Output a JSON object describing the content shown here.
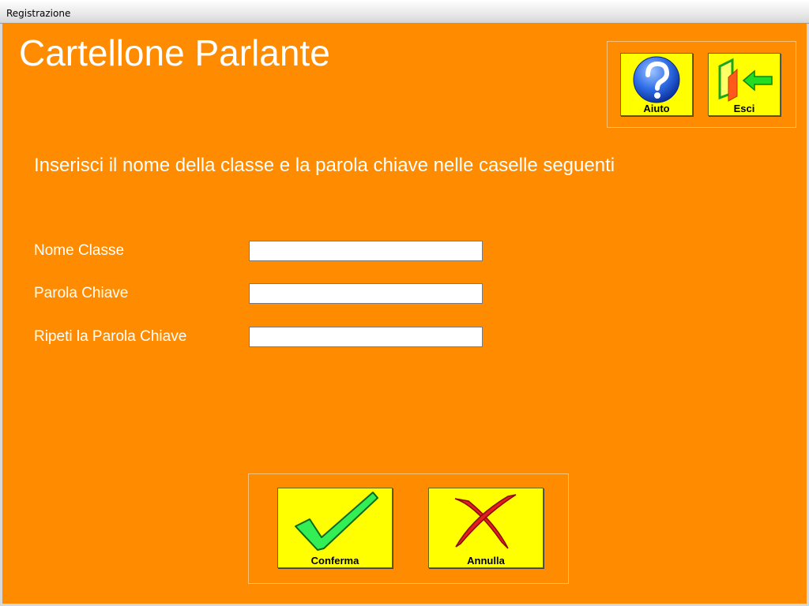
{
  "window": {
    "title": "Registrazione"
  },
  "app": {
    "title": "Cartellone Parlante"
  },
  "toolbar": {
    "help_label": "Aiuto",
    "exit_label": "Esci"
  },
  "form": {
    "instructions": "Inserisci il nome della classe e la parola chiave nelle caselle seguenti",
    "class_name_label": "Nome Classe",
    "class_name_value": "",
    "password_label": "Parola Chiave",
    "password_value": "",
    "repeat_password_label": "Ripeti la Parola Chiave",
    "repeat_password_value": ""
  },
  "actions": {
    "confirm_label": "Conferma",
    "cancel_label": "Annulla"
  },
  "colors": {
    "background": "#ff8c00",
    "button": "#ffff00",
    "text": "#ffffff"
  },
  "icons": {
    "help": "question-mark-icon",
    "exit": "exit-door-arrow-icon",
    "confirm": "check-mark-icon",
    "cancel": "x-cross-icon"
  }
}
